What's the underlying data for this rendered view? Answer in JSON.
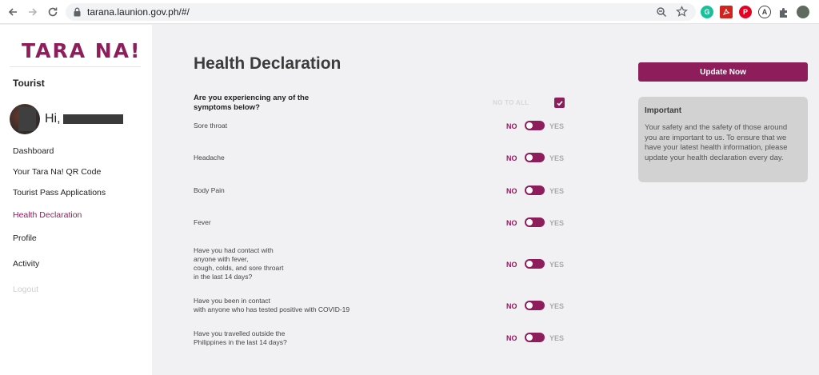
{
  "browser": {
    "url": "tarana.launion.gov.ph/#/"
  },
  "sidebar": {
    "logo": "TARA NA!",
    "role": "Tourist",
    "greeting": "Hi,",
    "items": [
      {
        "label": "Dashboard",
        "state": "normal"
      },
      {
        "label": "Your Tara Na! QR Code",
        "state": "normal"
      },
      {
        "label": "Tourist Pass Applications",
        "state": "normal"
      },
      {
        "label": "Health Declaration",
        "state": "active"
      },
      {
        "label": "Profile",
        "state": "normal"
      },
      {
        "label": "Activity",
        "state": "normal"
      },
      {
        "label": "Logout",
        "state": "muted"
      }
    ]
  },
  "main": {
    "title": "Health Declaration",
    "question": "Are you experiencing any of the symptoms below?",
    "no_to_all_label": "NO TO ALL",
    "no_to_all_checked": true,
    "no_label": "NO",
    "yes_label": "YES",
    "symptoms": [
      {
        "lines": [
          "Sore throat"
        ],
        "answer": "NO"
      },
      {
        "lines": [
          "Headache"
        ],
        "answer": "NO"
      },
      {
        "lines": [
          "Body Pain"
        ],
        "answer": "NO"
      },
      {
        "lines": [
          "Fever"
        ],
        "answer": "NO"
      },
      {
        "lines": [
          "Have you had contact with",
          "anyone with fever,",
          "cough, colds, and sore throart",
          "in the last 14 days?"
        ],
        "answer": "NO"
      },
      {
        "lines": [
          "Have you been in contact",
          "with anyone who has tested positive with COVID-19"
        ],
        "answer": "NO"
      },
      {
        "lines": [
          "Have you travelled outside the",
          "Philippines in the last 14 days?"
        ],
        "answer": "NO"
      }
    ]
  },
  "aside": {
    "update_button": "Update Now",
    "important_title": "Important",
    "important_body": "Your safety and the safety of those around you are important to us. To ensure that we have your latest health information, please update your health declaration every day."
  },
  "colors": {
    "brand": "#8e1d5c",
    "panel": "#d2d2d2",
    "background": "#f1f1f4"
  }
}
